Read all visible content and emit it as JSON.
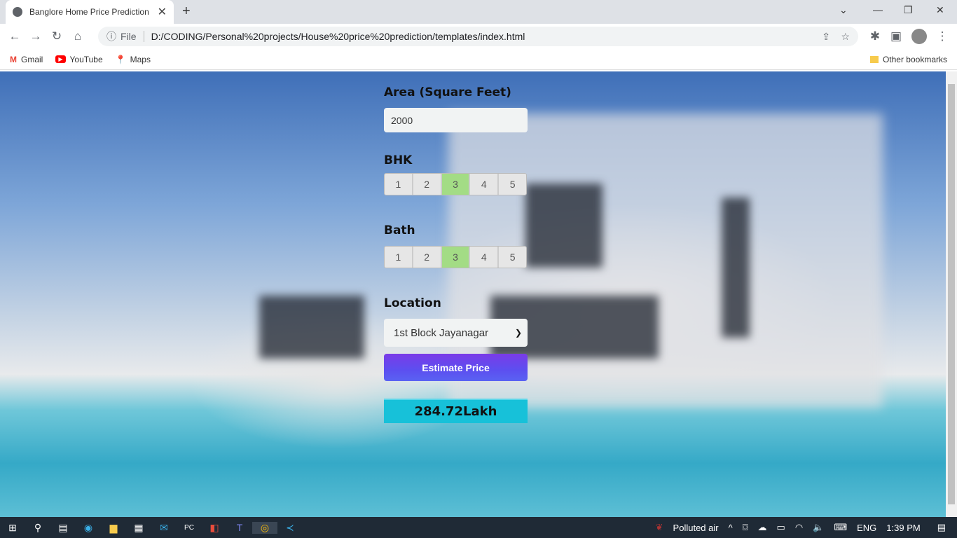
{
  "browser": {
    "tab_title": "Banglore Home Price Prediction",
    "url_scheme": "File",
    "url": "D:/CODING/Personal%20projects/House%20price%20prediction/templates/index.html",
    "bookmarks": [
      {
        "label": "Gmail",
        "color": "#ea4335"
      },
      {
        "label": "YouTube",
        "color": "#ff0000"
      },
      {
        "label": "Maps",
        "color": "#34a853"
      }
    ],
    "other_bookmarks": "Other bookmarks"
  },
  "form": {
    "area_label": "Area (Square Feet)",
    "area_value": "2000",
    "bhk_label": "BHK",
    "bhk_options": [
      "1",
      "2",
      "3",
      "4",
      "5"
    ],
    "bhk_selected": "3",
    "bath_label": "Bath",
    "bath_options": [
      "1",
      "2",
      "3",
      "4",
      "5"
    ],
    "bath_selected": "3",
    "location_label": "Location",
    "location_value": "1st Block Jayanagar",
    "estimate_button": "Estimate Price",
    "result": "284.72Lakh",
    "colors": {
      "selected": "#a3dc85",
      "button": "#6a45ee",
      "result": "#17c1d9"
    }
  },
  "taskbar": {
    "weather": "Polluted air",
    "language": "ENG",
    "time": "1:39 PM"
  }
}
